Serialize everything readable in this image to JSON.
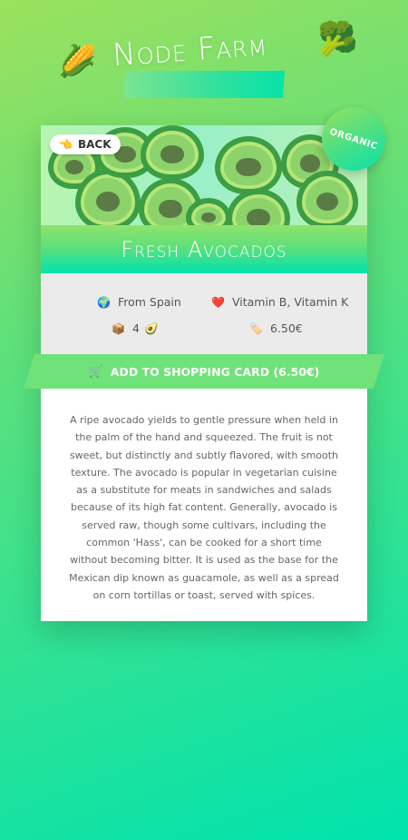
{
  "header": {
    "title": "Node Farm",
    "corn_icon": "corn-icon",
    "broccoli_icon": "broccoli-icon"
  },
  "card": {
    "back_label": "BACK",
    "back_icon": "pointing-hand-icon",
    "badge": "ORGANIC",
    "product_name": "Fresh Avocados",
    "origin": "From Spain",
    "nutrients": "Vitamin B, Vitamin K",
    "quantity": "4",
    "price": "6.50€",
    "cart_label": "ADD TO SHOPPING CARD (6.50€)",
    "description": "A ripe avocado yields to gentle pressure when held in the palm of the hand and squeezed. The fruit is not sweet, but distinctly and subtly flavored, with smooth texture. The avocado is popular in vegetarian cuisine as a substitute for meats in sandwiches and salads because of its high fat content. Generally, avocado is served raw, though some cultivars, including the common 'Hass', can be cooked for a short time without becoming bitter. It is used as the base for the Mexican dip known as guacamole, as well as a spread on corn tortillas or toast, served with spices."
  },
  "colors": {
    "accent": "#6fe27a",
    "badge": "#3fe08b",
    "background_start": "#9be15d",
    "background_end": "#00e3ae"
  }
}
